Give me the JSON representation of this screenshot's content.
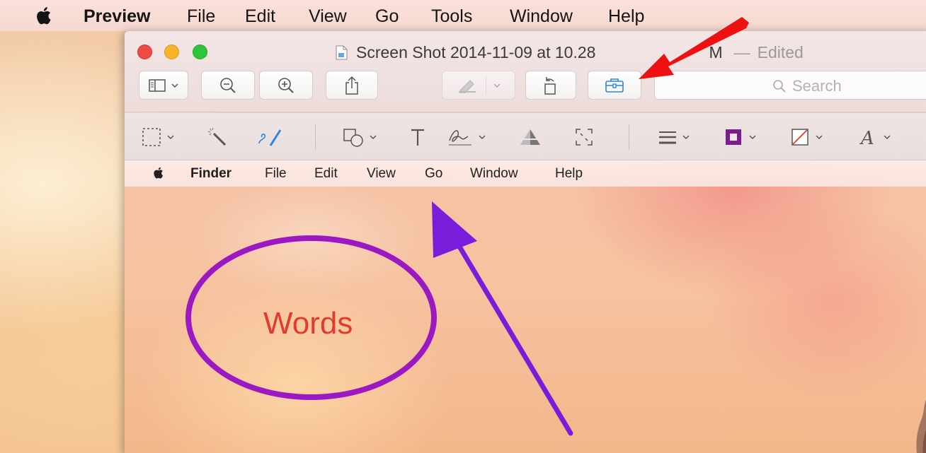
{
  "system_menubar": {
    "app_name": "Preview",
    "items": [
      "File",
      "Edit",
      "View",
      "Go",
      "Tools",
      "Window",
      "Help"
    ]
  },
  "window": {
    "title": "Screen Shot 2014-11-09 at 10.28",
    "title_obscured_suffix": "M",
    "title_dash": "—",
    "title_state": "Edited",
    "toolbar": {
      "icons": [
        "sidebar-icon",
        "zoom-out-icon",
        "zoom-in-icon",
        "share-icon",
        "highlight-icon",
        "rotate-icon",
        "toolbox-icon"
      ],
      "search_placeholder": "Search"
    },
    "markup_toolbar": {
      "icons": [
        "rectangular-selection-icon",
        "instant-alpha-icon",
        "sketch-icon",
        "shapes-icon",
        "text-icon",
        "signature-icon",
        "adjust-color-icon",
        "adjust-size-icon",
        "shape-style-icon",
        "border-color-icon",
        "fill-color-icon",
        "text-style-icon"
      ]
    }
  },
  "document": {
    "inner_menubar": {
      "app_name": "Finder",
      "items": [
        "File",
        "Edit",
        "View",
        "Go",
        "Window",
        "Help"
      ]
    },
    "annotation_text": "Words"
  },
  "colors": {
    "annotation_ellipse": "#9a19c2",
    "annotation_text": "#e23b2c",
    "purple_arrow": "#7a1ddb",
    "red_arrow": "#ee1111",
    "toolbox_icon": "#2a86e0"
  }
}
